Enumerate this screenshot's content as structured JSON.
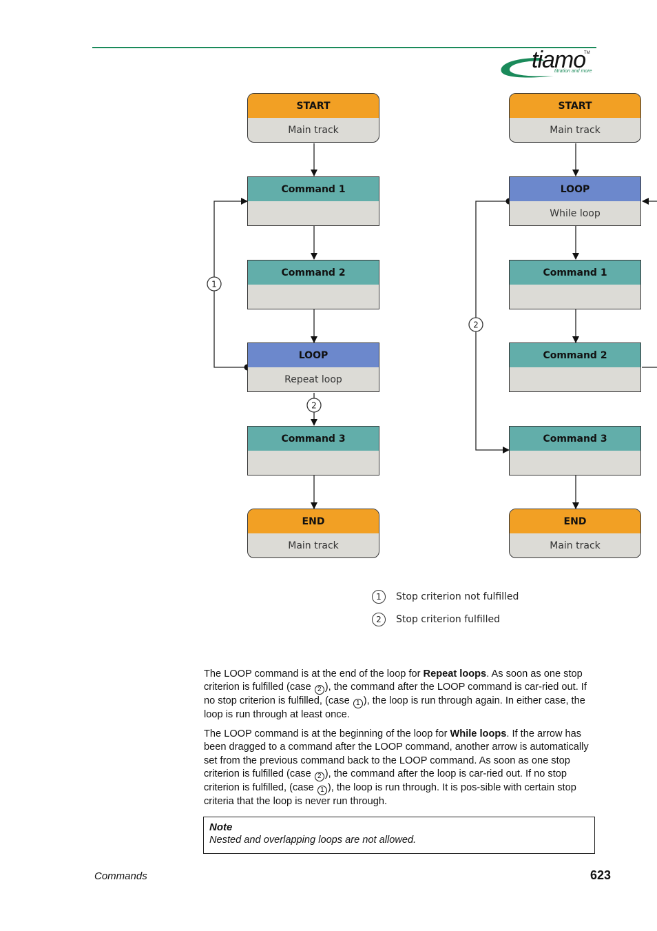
{
  "header": {
    "logo": {
      "word": "tiamo",
      "trademark": "TM",
      "tagline": "titration and more"
    },
    "colors": {
      "rule": "#1a8a5a",
      "start_end": "#f2a024",
      "command": "#62aeaa",
      "loop": "#6c88cc",
      "body": "#dcdbd6"
    }
  },
  "diagram_left": {
    "nodes": [
      {
        "title": "START",
        "subtitle": "Main track",
        "type": "start"
      },
      {
        "title": "Command 1",
        "subtitle": "",
        "type": "command"
      },
      {
        "title": "Command 2",
        "subtitle": "",
        "type": "command"
      },
      {
        "title": "LOOP",
        "subtitle": "Repeat loop",
        "type": "loop"
      },
      {
        "title": "Command 3",
        "subtitle": "",
        "type": "command"
      },
      {
        "title": "END",
        "subtitle": "Main track",
        "type": "end"
      }
    ],
    "markers": {
      "loop_back": "1",
      "exit": "2"
    }
  },
  "diagram_right": {
    "nodes": [
      {
        "title": "START",
        "subtitle": "Main track",
        "type": "start"
      },
      {
        "title": "LOOP",
        "subtitle": "While loop",
        "type": "loop"
      },
      {
        "title": "Command 1",
        "subtitle": "",
        "type": "command"
      },
      {
        "title": "Command 2",
        "subtitle": "",
        "type": "command"
      },
      {
        "title": "Command 3",
        "subtitle": "",
        "type": "command"
      },
      {
        "title": "END",
        "subtitle": "Main track",
        "type": "end"
      }
    ],
    "markers": {
      "exit": "2"
    }
  },
  "legend": [
    {
      "num": "1",
      "text": "Stop criterion not fulfilled"
    },
    {
      "num": "2",
      "text": "Stop criterion fulfilled"
    }
  ],
  "paragraphs": {
    "p1": {
      "a": "The LOOP command is at the end of the loop for ",
      "bold": "Repeat loops",
      "b": ". As soon as one stop criterion is fulfilled (case ",
      "c1": "2",
      "c": "), the command after the LOOP command is car-ried out. If no stop criterion is fulfilled, (case ",
      "c2": "1",
      "d": "), the loop is run through again. In either case, the loop is run through at least once."
    },
    "p2": {
      "a": "The LOOP command is at the beginning of the loop for ",
      "bold": "While loops",
      "b": ". If the arrow has been dragged to a command after the LOOP command, another arrow is automatically set from the previous command back to the LOOP command. As soon as one stop criterion is fulfilled (case ",
      "c1": "2",
      "c": "), the command after the loop is car-ried out. If no stop criterion is fulfilled, (case ",
      "c2": "1",
      "d": "), the loop is run through. It is pos-sible with certain stop criteria that the loop is never run through."
    }
  },
  "note": {
    "title": "Note",
    "text": "Nested and overlapping loops are not allowed."
  },
  "footer": {
    "section": "Commands",
    "page": "623"
  }
}
